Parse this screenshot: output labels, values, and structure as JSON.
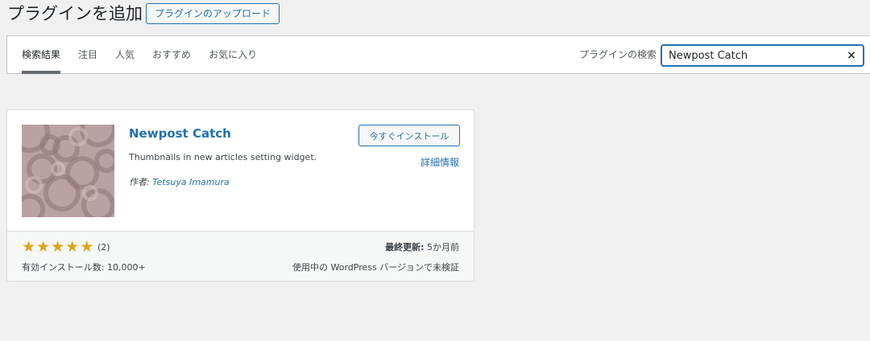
{
  "page": {
    "title": "プラグインを追加",
    "upload_label": "プラグインのアップロード"
  },
  "filter": {
    "tabs": [
      {
        "label": "検索結果"
      },
      {
        "label": "注目"
      },
      {
        "label": "人気"
      },
      {
        "label": "おすすめ"
      },
      {
        "label": "お気に入り"
      }
    ],
    "search_label": "プラグインの検索",
    "search_value": "Newpost Catch",
    "clear_icon": "×"
  },
  "plugin": {
    "name": "Newpost Catch",
    "description": "Thumbnails in new articles setting widget.",
    "author_prefix": "作者: ",
    "author": "Tetsuya Imamura",
    "install_label": "今すぐインストール",
    "details_label": "詳細情報",
    "rating": 5,
    "rating_count": "(2)",
    "installs": "有効インストール数: 10,000+",
    "updated_label": "最終更新:",
    "updated_value": " 5か月前",
    "compat": "使用中の WordPress バージョンで未検証"
  },
  "colors": {
    "accent": "#2271b1",
    "star": "#dba617",
    "thumbnail": "#bba1a3"
  }
}
